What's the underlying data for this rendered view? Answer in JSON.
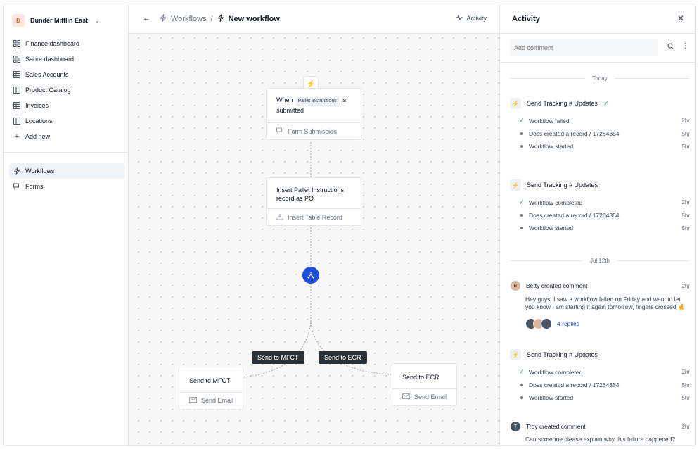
{
  "workspace": {
    "initial": "D",
    "name": "Dunder Mifflin East"
  },
  "sidebar": {
    "items": [
      {
        "label": "Finance dashboard",
        "icon": "dashboard-icon"
      },
      {
        "label": "Sabre dashboard",
        "icon": "dashboard-icon"
      },
      {
        "label": "Sales Accounts",
        "icon": "table-icon"
      },
      {
        "label": "Product Catalog",
        "icon": "table-icon"
      },
      {
        "label": "Invoices",
        "icon": "table-icon"
      },
      {
        "label": "Locations",
        "icon": "table-icon"
      },
      {
        "label": "Add new",
        "icon": "plus-icon"
      }
    ],
    "secondary": [
      {
        "label": "Workflows",
        "icon": "bolt-icon",
        "active": true
      },
      {
        "label": "Forms",
        "icon": "form-icon"
      }
    ]
  },
  "header": {
    "crumb_parent": "Workflows",
    "separator": "/",
    "crumb_current": "New workflow",
    "activity_label": "Activity"
  },
  "workflow": {
    "trigger": {
      "before": "When",
      "pill": "Pallet Instructions",
      "after": "is",
      "line2": "submitted",
      "footer": "Form Submission"
    },
    "insert": {
      "line1": "Insert Pallet Instructions",
      "line2": "record as PO",
      "footer": "Insert Table Record"
    },
    "branch_left_tag": "Send to MFCT",
    "branch_right_tag": "Send to ECR",
    "left_node": {
      "title": "Send to MFCT",
      "footer": "Send Email"
    },
    "right_node": {
      "title": "Send to ECR",
      "footer": "Send Email"
    }
  },
  "activity": {
    "title": "Activity",
    "comment_placeholder": "Add comment",
    "day1": "Today",
    "group1": {
      "title": "Send Tracking # Updates",
      "events": [
        {
          "text": "Workflow failed",
          "time": "2hr"
        },
        {
          "text": "Doss created a record  /   17264354",
          "time": "5hr"
        },
        {
          "text": "Workflow started",
          "time": "5hr"
        }
      ]
    },
    "group2": {
      "title": "Send Tracking # Updates",
      "events": [
        {
          "text": "Workflow completed",
          "time": "2hr"
        },
        {
          "text": "Doss created a record  /   17264354",
          "time": "5hr"
        },
        {
          "text": "Workflow started",
          "time": "5hr"
        }
      ]
    },
    "day2": "Jul 12th",
    "comment1": {
      "author": "Betty created comment",
      "time": "2hr",
      "text": "Hey guys! I saw a workflow failed on Friday and want to let you know I am starting it again tomorrow, fingers crossed 🤞",
      "replies": "4 replies"
    },
    "group3": {
      "title": "Send Tracking # Updates",
      "events": [
        {
          "text": "Workflow completed",
          "time": "2hr"
        },
        {
          "text": "Doss created a record  /   17264354",
          "time": "5hr"
        },
        {
          "text": "Workflow started",
          "time": "5hr"
        }
      ]
    },
    "comment2": {
      "author": "Troy created comment",
      "time": "2hr",
      "text": "Can someone please explain why this failure happened?"
    }
  },
  "colors": {
    "accent": "#1d4ed8",
    "success": "#16a34a",
    "tag_bg": "#2b2f36"
  }
}
